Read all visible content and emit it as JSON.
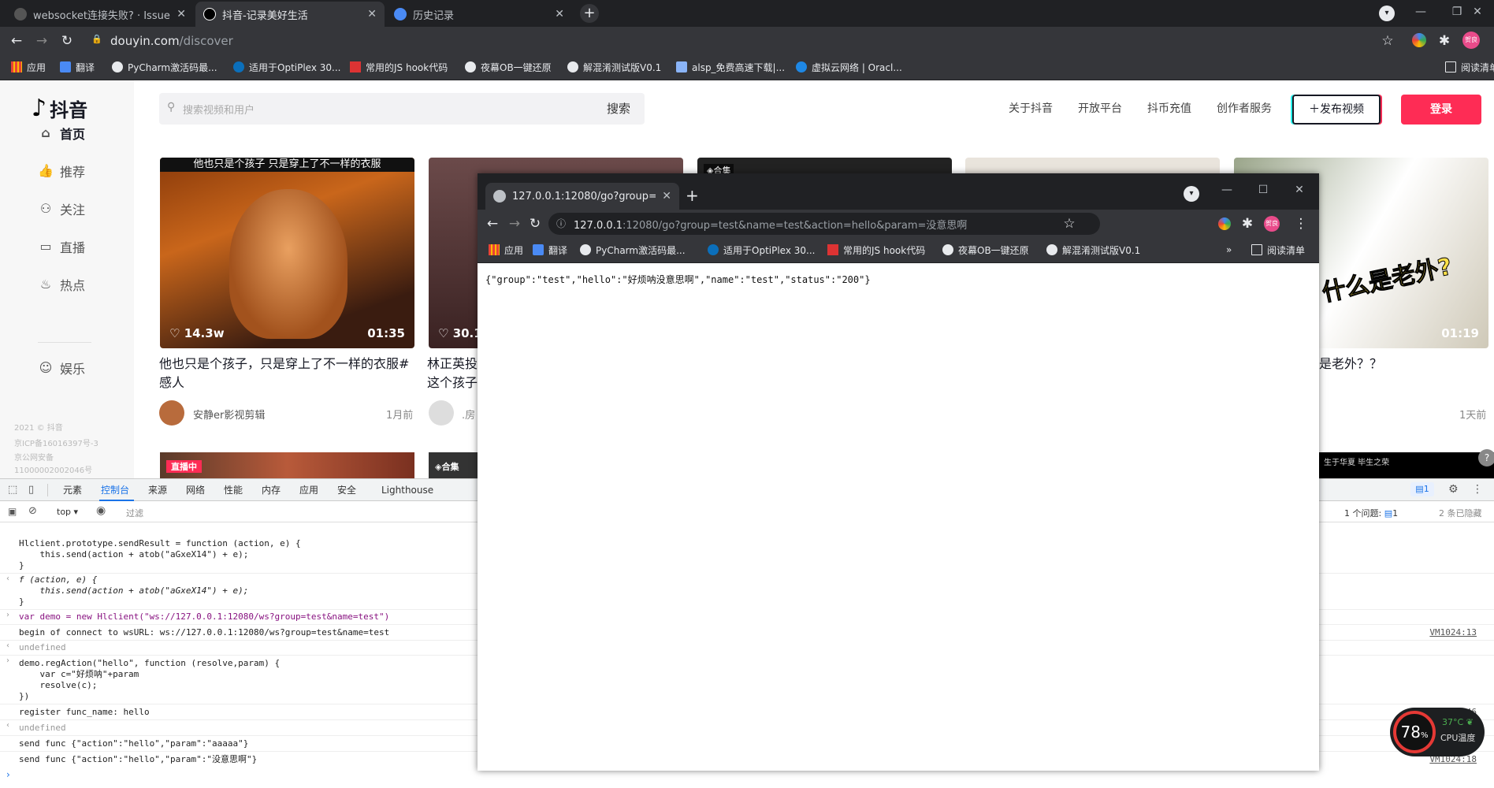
{
  "browser": {
    "tabs": [
      {
        "title": "websocket连接失败? · Issue #",
        "active": false
      },
      {
        "title": "抖音-记录美好生活",
        "active": true
      },
      {
        "title": "历史记录",
        "active": false
      }
    ],
    "new_tab_icon": "plus-icon",
    "url_host": "douyin.com",
    "url_path": "/discover",
    "profile_label": "贺良",
    "bookmarks": [
      "应用",
      "翻译",
      "PyCharm激活码最...",
      "适用于OptiPlex 30...",
      "常用的JS hook代码",
      "夜幕OB一键还原",
      "解混淆测试版V0.1",
      "alsp_免费高速下载|...",
      "虚拟云网络 | Oracl..."
    ],
    "reading_list": "阅读清单"
  },
  "douyin": {
    "logo_text": "抖音",
    "search_placeholder": "搜索视频和用户",
    "search_button": "搜索",
    "top_links": [
      "关于抖音",
      "开放平台",
      "抖币充值",
      "创作者服务"
    ],
    "publish_button": "发布视频",
    "login_button": "登录",
    "nav": [
      "首页",
      "推荐",
      "关注",
      "直播",
      "热点",
      "娱乐"
    ],
    "footer": [
      "2021 © 抖音",
      "京ICP备16016397号-3",
      "京公网安备",
      "11000002002046号"
    ],
    "cards": [
      {
        "caption": "他也只是个孩子  只是穿上了不一样的衣服",
        "likes": "14.3w",
        "duration": "01:35",
        "title_l1": "他也只是个孩子，只是穿上了不一样的衣服#",
        "title_l2": "感人",
        "author": "安静er影视剪辑",
        "time": "1月前"
      },
      {
        "likes": "30.1",
        "title_l1": "林正英投",
        "title_l2": "这个孩子",
        "author": ".房"
      },
      {
        "badge": "合集"
      },
      {},
      {
        "duration": "01:19",
        "title_l1": "是老外？？",
        "time": "1天前",
        "overlay_text": "什么是老外?"
      }
    ],
    "row2_badges": [
      "直播中",
      "合集"
    ],
    "row2_strip": "生于华夏 毕生之荣"
  },
  "devtools": {
    "tabs": [
      "元素",
      "控制台",
      "来源",
      "网络",
      "性能",
      "内存",
      "应用",
      "安全",
      "Lighthouse"
    ],
    "active_tab": "控制台",
    "context": "top",
    "filter_placeholder": "过滤",
    "issues_badge": "1",
    "issues_text": "1 个问题:",
    "issues_count": "1",
    "hidden_text": "2 条已隐藏",
    "lines": [
      "Hlclient.prototype.sendResult = function (action, e) {",
      "    this.send(action + atob(\"aGxeX14\") + e);",
      "}",
      "f (action, e) {",
      "    this.send(action + atob(\"aGxeX14\") + e);",
      "}",
      "var demo = new Hlclient(\"ws://127.0.0.1:12080/ws?group=test&name=test\")",
      "begin of connect to wsURL: ws://127.0.0.1:12080/ws?group=test&name=test",
      "undefined",
      "demo.regAction(\"hello\", function (resolve,param) {",
      "    var c=\"好烦呐\"+param",
      "    resolve(c);",
      "})",
      "register func_name: hello",
      "undefined",
      "send func {\"action\":\"hello\",\"param\":\"aaaaa\"}",
      "send func {\"action\":\"hello\",\"param\":\"没意思啊\"}"
    ],
    "sources": [
      "VM1024:13",
      "VM1024:46",
      "VM1024:18"
    ]
  },
  "popup": {
    "tab_title": "127.0.0.1:12080/go?group=te",
    "url_host": "127.0.0.1",
    "url_rest": ":12080/go?group=test&name=test&action=hello&param=没意思啊",
    "bookmarks": [
      "应用",
      "翻译",
      "PyCharm激活码最...",
      "适用于OptiPlex 30...",
      "常用的JS hook代码",
      "夜幕OB一键还原",
      "解混淆测试版V0.1"
    ],
    "reading_list": "阅读清单",
    "body": "{\"group\":\"test\",\"hello\":\"好烦呐没意思啊\",\"name\":\"test\",\"status\":\"200\"}"
  },
  "cpu_widget": {
    "percent": "78",
    "percent_unit": "%",
    "temp": "37°C",
    "label": "CPU温度"
  }
}
